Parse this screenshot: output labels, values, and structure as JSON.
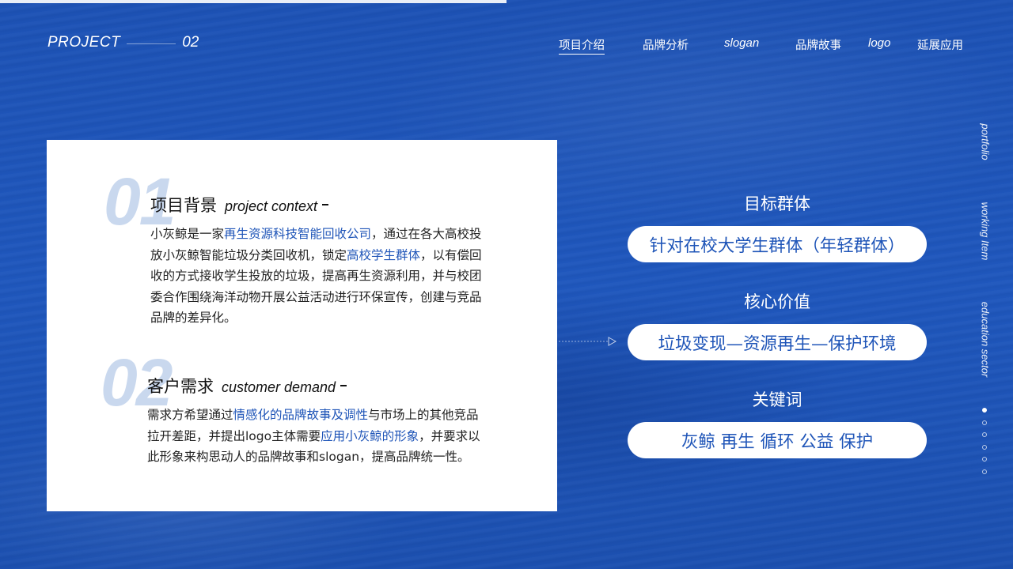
{
  "header": {
    "project_word": "PROJECT",
    "project_num": "02"
  },
  "nav": [
    {
      "label": "项目介绍",
      "active": true
    },
    {
      "label": "品牌分析",
      "active": false
    },
    {
      "label": "slogan",
      "active": false
    },
    {
      "label": "品牌故事",
      "active": false
    },
    {
      "label": "logo",
      "active": false
    },
    {
      "label": "延展应用",
      "active": false
    }
  ],
  "sections": [
    {
      "num": "01",
      "title_zh": "项目背景",
      "title_en": "project  context",
      "body": [
        {
          "t": "小灰鲸是一家",
          "hl": false
        },
        {
          "t": "再生资源科技智能回收公司",
          "hl": true
        },
        {
          "t": "，通过在各大高校投放小灰鲸智能垃圾分类回收机，锁定",
          "hl": false
        },
        {
          "t": "高校学生群体",
          "hl": true
        },
        {
          "t": "，以有偿回收的方式接收学生投放的垃圾，提高再生资源利用，并与校团委合作围绕海洋动物开展公益活动进行环保宣传，创建与竞品品牌的差异化。",
          "hl": false
        }
      ]
    },
    {
      "num": "02",
      "title_zh": "客户需求",
      "title_en": "customer demand",
      "body": [
        {
          "t": "需求方希望通过",
          "hl": false
        },
        {
          "t": "情感化的品牌故事及调性",
          "hl": true
        },
        {
          "t": "与市场上的其他竞品拉开差距，并提出logo主体需要",
          "hl": false
        },
        {
          "t": "应用小灰鲸的形象",
          "hl": true
        },
        {
          "t": "，并要求以此形象来构思动人的品牌故事和slogan，提高品牌统一性。",
          "hl": false
        }
      ]
    }
  ],
  "keywords": [
    {
      "heading": "目标群体",
      "pill": "针对在校大学生群体（年轻群体）"
    },
    {
      "heading": "核心价值",
      "pill": "垃圾变现—资源再生—保护环境"
    },
    {
      "heading": "关键词",
      "pill": "灰鲸 再生 循环 公益 保护"
    }
  ],
  "side_labels": [
    "portfolio",
    "working Item",
    "education sector"
  ],
  "page_dots": {
    "total": 6,
    "active": 1
  },
  "colors": {
    "brand_blue": "#1f55b8",
    "number_tint": "#c9d8ee",
    "card_bg": "#ffffff"
  }
}
